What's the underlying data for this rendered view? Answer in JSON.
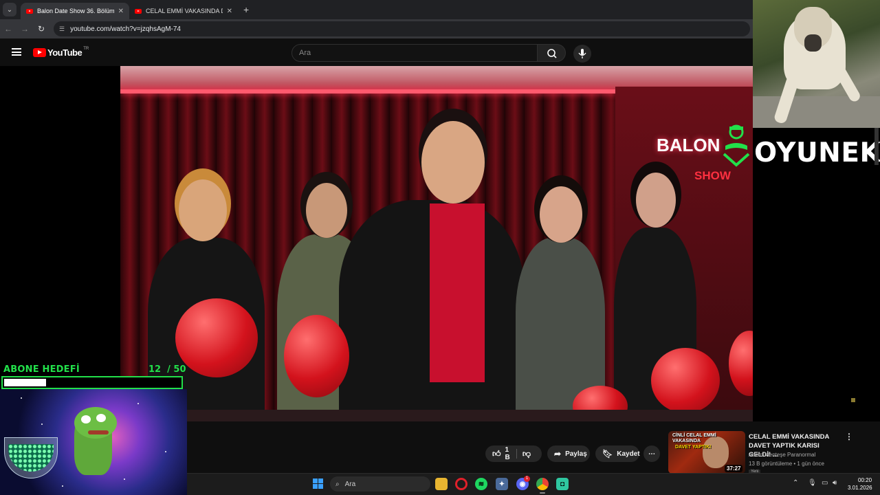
{
  "browser": {
    "tabs": [
      {
        "title": "Balon Date Show 36. Bölüm - Yo",
        "active": true
      },
      {
        "title": "CELAL EMMİ VAKASINDA DAVET",
        "active": false
      }
    ],
    "url": "youtube.com/watch?v=jzqhsAgM-74"
  },
  "youtube": {
    "logo_text": "YouTube",
    "country_code": "TR",
    "search_placeholder": "Ara"
  },
  "video": {
    "logo_text": "BALON",
    "logo_sub": "SHOW"
  },
  "actions": {
    "like_count": "1 B",
    "share_label": "Paylaş",
    "save_label": "Kaydet",
    "more_label": "⋯"
  },
  "recommended": {
    "thumb_line1": "CİNLİ CELAL EMMİ VAKASINDA",
    "thumb_line2": "DAVET YAPTIK!",
    "duration": "37:27",
    "title": "CELAL EMMİ VAKASINDA DAVET YAPTIK KARISI GELDİ! ...",
    "channel": "Adem Menteşe Paranormal",
    "meta": "13 B görüntüleme • 1 gün önce",
    "badge": "Yeni"
  },
  "stream_overlay": {
    "brand": "OYUNEKS",
    "goal_title": "ABONE HEDEFİ",
    "goal_current": "12",
    "goal_total": "/ 50",
    "goal_progress": 0.24
  },
  "taskbar": {
    "search_placeholder": "Ara",
    "time": "00:20",
    "date": "3.01.2026",
    "discord_badge": "1"
  },
  "colors": {
    "accent_green": "#22e04a",
    "youtube_red": "#ff0000",
    "background": "#0f0f0f"
  }
}
